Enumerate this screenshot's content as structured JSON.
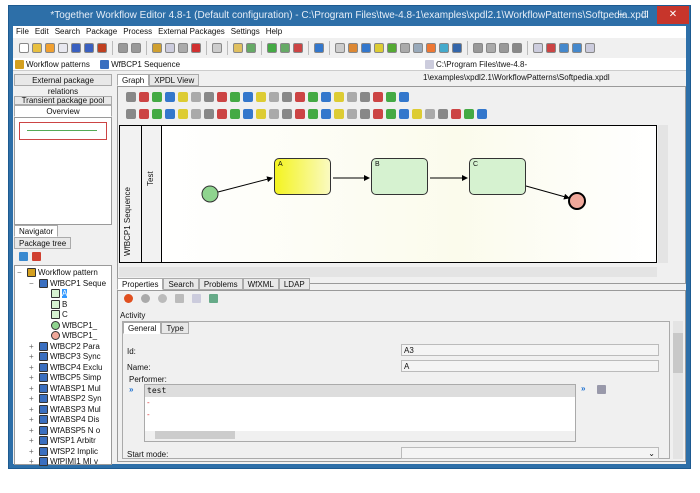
{
  "window": {
    "title": "*Together Workflow Editor 4.8-1 (Default configuration) - C:\\Program Files\\twe-4.8-1\\examples\\xpdl2.1\\WorkflowPatterns\\Softpedia.xpdl",
    "minimize": "–",
    "maximize": "□",
    "close": "✕"
  },
  "menu": [
    "File",
    "Edit",
    "Search",
    "Package",
    "Process",
    "External Packages",
    "Settings",
    "Help"
  ],
  "breadcrumb": {
    "package": "Workflow patterns",
    "process": "WfBCP1 Sequence",
    "file": "C:\\Program Files\\twe-4.8-1\\examples\\xpdl2.1\\WorkflowPatterns\\Softpedia.xpdl"
  },
  "left": {
    "tabs": [
      "External package relations",
      "Transient package pool",
      "Overview"
    ],
    "nav_tabs": [
      "Navigator",
      "Package tree"
    ],
    "tree": [
      {
        "label": "Workflow pattern",
        "level": 0,
        "exp": "−"
      },
      {
        "label": "WfBCP1 Seque",
        "level": 1,
        "exp": "−"
      },
      {
        "label": "A",
        "level": 2,
        "exp": "",
        "sel": true
      },
      {
        "label": "B",
        "level": 2,
        "exp": ""
      },
      {
        "label": "C",
        "level": 2,
        "exp": ""
      },
      {
        "label": "WfBCP1_",
        "level": 2,
        "exp": ""
      },
      {
        "label": "WfBCP1_",
        "level": 2,
        "exp": ""
      },
      {
        "label": "WfBCP2 Para",
        "level": 1,
        "exp": "+"
      },
      {
        "label": "WfBCP3 Sync",
        "level": 1,
        "exp": "+"
      },
      {
        "label": "WfBCP4 Exclu",
        "level": 1,
        "exp": "+"
      },
      {
        "label": "WfBCP5 Simp",
        "level": 1,
        "exp": "+"
      },
      {
        "label": "WfABSP1 Mul",
        "level": 1,
        "exp": "+"
      },
      {
        "label": "WfABSP2 Syn",
        "level": 1,
        "exp": "+"
      },
      {
        "label": "WfABSP3 Mul",
        "level": 1,
        "exp": "+"
      },
      {
        "label": "WfABSP4 Dis",
        "level": 1,
        "exp": "+"
      },
      {
        "label": "WfABSP5 N o",
        "level": 1,
        "exp": "+"
      },
      {
        "label": "WfSP1 Arbitr",
        "level": 1,
        "exp": "+"
      },
      {
        "label": "WfSP2 Implic",
        "level": 1,
        "exp": "+"
      },
      {
        "label": "WfPIMI1 MI v",
        "level": 1,
        "exp": "+"
      }
    ]
  },
  "graph": {
    "tabs": [
      "Graph",
      "XPDL View"
    ],
    "pool": "WfBCP1 Sequence",
    "lane": "Test",
    "activities": [
      "A",
      "B",
      "C"
    ]
  },
  "props": {
    "tabs": [
      "Properties",
      "Search",
      "Problems",
      "WfXML",
      "LDAP"
    ],
    "section": "Activity",
    "subtabs": [
      "General",
      "Type"
    ],
    "id_label": "Id:",
    "id_value": "A3",
    "name_label": "Name:",
    "name_value": "A",
    "performer_label": "Performer:",
    "performer_value": "test",
    "start_mode_label": "Start mode:"
  },
  "colors": {
    "frame": "#2d6fa8",
    "close": "#c7352b",
    "selected": "#3399ff"
  }
}
